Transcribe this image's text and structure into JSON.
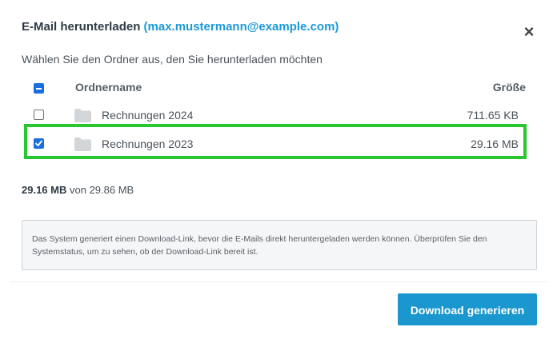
{
  "dialog": {
    "title": "E-Mail herunterladen",
    "email": "(max.mustermann@example.com)",
    "close_label": "×",
    "subtitle": "Wählen Sie den Ordner aus, den Sie herunterladen möchten"
  },
  "table": {
    "header_name": "Ordnername",
    "header_size": "Größe",
    "select_all_state": "indeterminate",
    "rows": [
      {
        "name": "Rechnungen 2024",
        "size": "711.65 KB",
        "checked": false
      },
      {
        "name": "Rechnungen 2023",
        "size": "29.16 MB",
        "checked": true
      }
    ]
  },
  "summary": {
    "selected": "29.16 MB",
    "rest": "von 29.86 MB"
  },
  "notice": "Das System generiert einen Download-Link, bevor die E-Mails direkt heruntergeladen werden können. Überprüfen Sie den Systemstatus, um zu sehen, ob der Download-Link bereit ist.",
  "footer": {
    "button_label": "Download generieren"
  },
  "colors": {
    "accent": "#1a97cf",
    "email_link": "#1a9ad6",
    "checkbox_checked": "#1a6fe0",
    "highlight": "#28c62f",
    "folder_icon": "#d3d6d9"
  }
}
